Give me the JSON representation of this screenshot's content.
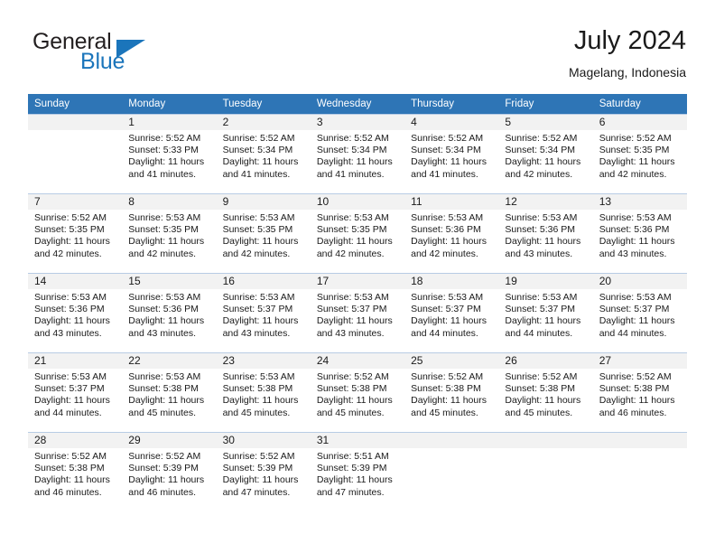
{
  "logo": {
    "word_one": "General",
    "word_two": "Blue",
    "accent_color": "#1b75bb"
  },
  "header": {
    "month_title": "July 2024",
    "location": "Magelang, Indonesia"
  },
  "calendar": {
    "header_background": "#2e75b6",
    "shaded_cell_color": "#f2f2f2",
    "grid_line_color": "#b8cce4",
    "weekday_headers": [
      "Sunday",
      "Monday",
      "Tuesday",
      "Wednesday",
      "Thursday",
      "Friday",
      "Saturday"
    ],
    "weeks": [
      [
        {
          "day": "",
          "lines": []
        },
        {
          "day": "1",
          "lines": [
            "Sunrise: 5:52 AM",
            "Sunset: 5:33 PM",
            "Daylight: 11 hours",
            "and 41 minutes."
          ]
        },
        {
          "day": "2",
          "lines": [
            "Sunrise: 5:52 AM",
            "Sunset: 5:34 PM",
            "Daylight: 11 hours",
            "and 41 minutes."
          ]
        },
        {
          "day": "3",
          "lines": [
            "Sunrise: 5:52 AM",
            "Sunset: 5:34 PM",
            "Daylight: 11 hours",
            "and 41 minutes."
          ]
        },
        {
          "day": "4",
          "lines": [
            "Sunrise: 5:52 AM",
            "Sunset: 5:34 PM",
            "Daylight: 11 hours",
            "and 41 minutes."
          ]
        },
        {
          "day": "5",
          "lines": [
            "Sunrise: 5:52 AM",
            "Sunset: 5:34 PM",
            "Daylight: 11 hours",
            "and 42 minutes."
          ]
        },
        {
          "day": "6",
          "lines": [
            "Sunrise: 5:52 AM",
            "Sunset: 5:35 PM",
            "Daylight: 11 hours",
            "and 42 minutes."
          ]
        }
      ],
      [
        {
          "day": "7",
          "lines": [
            "Sunrise: 5:52 AM",
            "Sunset: 5:35 PM",
            "Daylight: 11 hours",
            "and 42 minutes."
          ]
        },
        {
          "day": "8",
          "lines": [
            "Sunrise: 5:53 AM",
            "Sunset: 5:35 PM",
            "Daylight: 11 hours",
            "and 42 minutes."
          ]
        },
        {
          "day": "9",
          "lines": [
            "Sunrise: 5:53 AM",
            "Sunset: 5:35 PM",
            "Daylight: 11 hours",
            "and 42 minutes."
          ]
        },
        {
          "day": "10",
          "lines": [
            "Sunrise: 5:53 AM",
            "Sunset: 5:35 PM",
            "Daylight: 11 hours",
            "and 42 minutes."
          ]
        },
        {
          "day": "11",
          "lines": [
            "Sunrise: 5:53 AM",
            "Sunset: 5:36 PM",
            "Daylight: 11 hours",
            "and 42 minutes."
          ]
        },
        {
          "day": "12",
          "lines": [
            "Sunrise: 5:53 AM",
            "Sunset: 5:36 PM",
            "Daylight: 11 hours",
            "and 43 minutes."
          ]
        },
        {
          "day": "13",
          "lines": [
            "Sunrise: 5:53 AM",
            "Sunset: 5:36 PM",
            "Daylight: 11 hours",
            "and 43 minutes."
          ]
        }
      ],
      [
        {
          "day": "14",
          "lines": [
            "Sunrise: 5:53 AM",
            "Sunset: 5:36 PM",
            "Daylight: 11 hours",
            "and 43 minutes."
          ]
        },
        {
          "day": "15",
          "lines": [
            "Sunrise: 5:53 AM",
            "Sunset: 5:36 PM",
            "Daylight: 11 hours",
            "and 43 minutes."
          ]
        },
        {
          "day": "16",
          "lines": [
            "Sunrise: 5:53 AM",
            "Sunset: 5:37 PM",
            "Daylight: 11 hours",
            "and 43 minutes."
          ]
        },
        {
          "day": "17",
          "lines": [
            "Sunrise: 5:53 AM",
            "Sunset: 5:37 PM",
            "Daylight: 11 hours",
            "and 43 minutes."
          ]
        },
        {
          "day": "18",
          "lines": [
            "Sunrise: 5:53 AM",
            "Sunset: 5:37 PM",
            "Daylight: 11 hours",
            "and 44 minutes."
          ]
        },
        {
          "day": "19",
          "lines": [
            "Sunrise: 5:53 AM",
            "Sunset: 5:37 PM",
            "Daylight: 11 hours",
            "and 44 minutes."
          ]
        },
        {
          "day": "20",
          "lines": [
            "Sunrise: 5:53 AM",
            "Sunset: 5:37 PM",
            "Daylight: 11 hours",
            "and 44 minutes."
          ]
        }
      ],
      [
        {
          "day": "21",
          "lines": [
            "Sunrise: 5:53 AM",
            "Sunset: 5:37 PM",
            "Daylight: 11 hours",
            "and 44 minutes."
          ]
        },
        {
          "day": "22",
          "lines": [
            "Sunrise: 5:53 AM",
            "Sunset: 5:38 PM",
            "Daylight: 11 hours",
            "and 45 minutes."
          ]
        },
        {
          "day": "23",
          "lines": [
            "Sunrise: 5:53 AM",
            "Sunset: 5:38 PM",
            "Daylight: 11 hours",
            "and 45 minutes."
          ]
        },
        {
          "day": "24",
          "lines": [
            "Sunrise: 5:52 AM",
            "Sunset: 5:38 PM",
            "Daylight: 11 hours",
            "and 45 minutes."
          ]
        },
        {
          "day": "25",
          "lines": [
            "Sunrise: 5:52 AM",
            "Sunset: 5:38 PM",
            "Daylight: 11 hours",
            "and 45 minutes."
          ]
        },
        {
          "day": "26",
          "lines": [
            "Sunrise: 5:52 AM",
            "Sunset: 5:38 PM",
            "Daylight: 11 hours",
            "and 45 minutes."
          ]
        },
        {
          "day": "27",
          "lines": [
            "Sunrise: 5:52 AM",
            "Sunset: 5:38 PM",
            "Daylight: 11 hours",
            "and 46 minutes."
          ]
        }
      ],
      [
        {
          "day": "28",
          "lines": [
            "Sunrise: 5:52 AM",
            "Sunset: 5:38 PM",
            "Daylight: 11 hours",
            "and 46 minutes."
          ]
        },
        {
          "day": "29",
          "lines": [
            "Sunrise: 5:52 AM",
            "Sunset: 5:39 PM",
            "Daylight: 11 hours",
            "and 46 minutes."
          ]
        },
        {
          "day": "30",
          "lines": [
            "Sunrise: 5:52 AM",
            "Sunset: 5:39 PM",
            "Daylight: 11 hours",
            "and 47 minutes."
          ]
        },
        {
          "day": "31",
          "lines": [
            "Sunrise: 5:51 AM",
            "Sunset: 5:39 PM",
            "Daylight: 11 hours",
            "and 47 minutes."
          ]
        },
        {
          "day": "",
          "lines": []
        },
        {
          "day": "",
          "lines": []
        },
        {
          "day": "",
          "lines": []
        }
      ]
    ]
  }
}
